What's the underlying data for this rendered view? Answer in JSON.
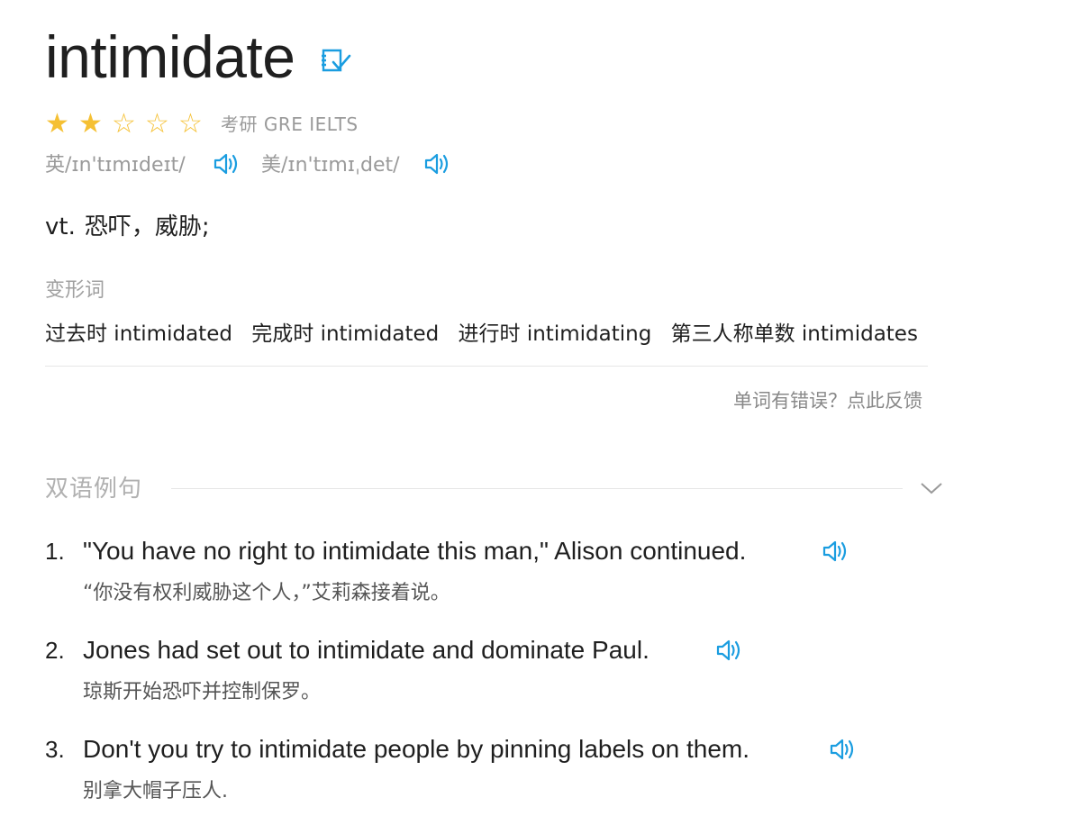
{
  "entry": {
    "word": "intimidate",
    "rating": 2,
    "rating_max": 5,
    "exam_tags": "考研 GRE IELTS",
    "phonetics": [
      {
        "label": "英/ɪn'tɪmɪdeɪt/"
      },
      {
        "label": "美/ɪn'tɪmɪˌdet/"
      }
    ],
    "definition": {
      "pos": "vt.",
      "meaning": "恐吓，威胁;"
    },
    "forms_label": "变形词",
    "forms": [
      "过去时 intimidated",
      "完成时 intimidated",
      "进行时 intimidating",
      "第三人称单数 intimidates"
    ],
    "feedback_link": "单词有错误？点此反馈"
  },
  "examples_section": {
    "title": "双语例句",
    "items": [
      {
        "num": "1.",
        "en": "\"You have no right to intimidate this man,\" Alison continued.",
        "zh": "“你没有权利威胁这个人，”艾莉森接着说。"
      },
      {
        "num": "2.",
        "en": "Jones had set out to intimidate and dominate Paul.",
        "zh": "琼斯开始恐吓并控制保罗。"
      },
      {
        "num": "3.",
        "en": "Don't you try to intimidate people by pinning labels on them.",
        "zh": "别拿大帽子压人."
      }
    ]
  },
  "icons": {
    "wordbook": "add-to-wordbook-icon",
    "speaker": "speaker-icon",
    "collapse": "chevron-down-icon"
  },
  "colors": {
    "accent": "#1a9de0",
    "star": "#f5c033",
    "muted": "#9a9a9a"
  }
}
